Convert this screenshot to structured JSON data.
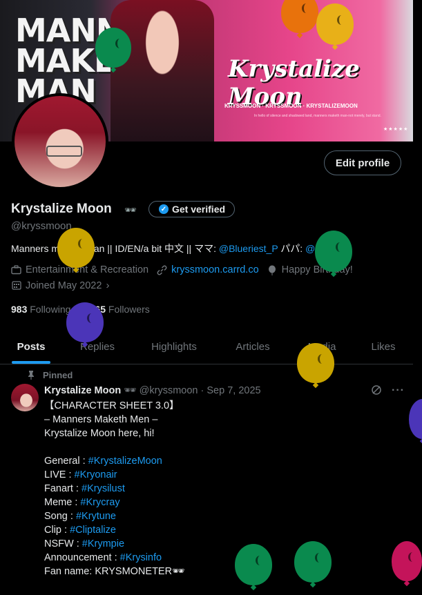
{
  "banner": {
    "slogan_lines": [
      "MANNERS",
      "MAKETH",
      "MAN"
    ],
    "logo_text": "Krystalize Moon",
    "socials": "KRYSSMOON · KRYSSMOON · KRYSTALIZEMOON",
    "tagline": "In hello of silence and shadowed land, manners maketh man-not merely, but stand.",
    "stars": "★★★★★"
  },
  "profile": {
    "edit_label": "Edit profile",
    "name": "Krystalize Moon",
    "name_emoji": "🕶",
    "verified_label": "Get verified",
    "handle": "@kryssmoon",
    "bio_text": "Manners maketh man || ID/EN/a bit 中文 || ママ: ",
    "bio_link1": "@Blueriest_P",
    "bio_mid": " パパ: ",
    "bio_link2": "@saikafuri",
    "category": "Entertainment & Recreation",
    "website": "kryssmoon.carrd.co",
    "birthday": "Happy Birthday!",
    "joined": "Joined May 2022",
    "following_count": "983",
    "following_label": "Following",
    "followers_count": "3,765",
    "followers_label": "Followers"
  },
  "tabs": [
    {
      "label": "Posts"
    },
    {
      "label": "Replies"
    },
    {
      "label": "Highlights"
    },
    {
      "label": "Articles"
    },
    {
      "label": "Media"
    },
    {
      "label": "Likes"
    }
  ],
  "post": {
    "pinned_label": "Pinned",
    "author": "Krystalize Moon",
    "author_emoji": "🕶",
    "meta": "@kryssmoon · Sep 7, 2025",
    "lines": [
      {
        "text": "【CHARACTER SHEET 3.0】",
        "tag": ""
      },
      {
        "text": "– Manners Maketh Men –",
        "tag": ""
      },
      {
        "text": "Krystalize Moon here, hi!",
        "tag": ""
      },
      {
        "text": "",
        "tag": ""
      },
      {
        "text": "General : ",
        "tag": "#KrystalizeMoon"
      },
      {
        "text": "LIVE : ",
        "tag": "#Kryonair"
      },
      {
        "text": "Fanart : ",
        "tag": "#Krysilust"
      },
      {
        "text": "Meme : ",
        "tag": "#Krycray"
      },
      {
        "text": "Song : ",
        "tag": "#Krytune"
      },
      {
        "text": "Clip : ",
        "tag": "#Cliptalize"
      },
      {
        "text": "NSFW : ",
        "tag": "#Krympie"
      },
      {
        "text": "Announcement : ",
        "tag": "#Krysinfo"
      },
      {
        "text": "Fan name: KRYSMONETER🕶",
        "tag": ""
      }
    ]
  },
  "colors": {
    "accent": "#1d9bf0",
    "balloon_green": "#0a8a4e",
    "balloon_gold": "#c9a400",
    "balloon_purple": "#4b35b8",
    "balloon_pink": "#c4145a",
    "balloon_orange": "#e8720c"
  }
}
